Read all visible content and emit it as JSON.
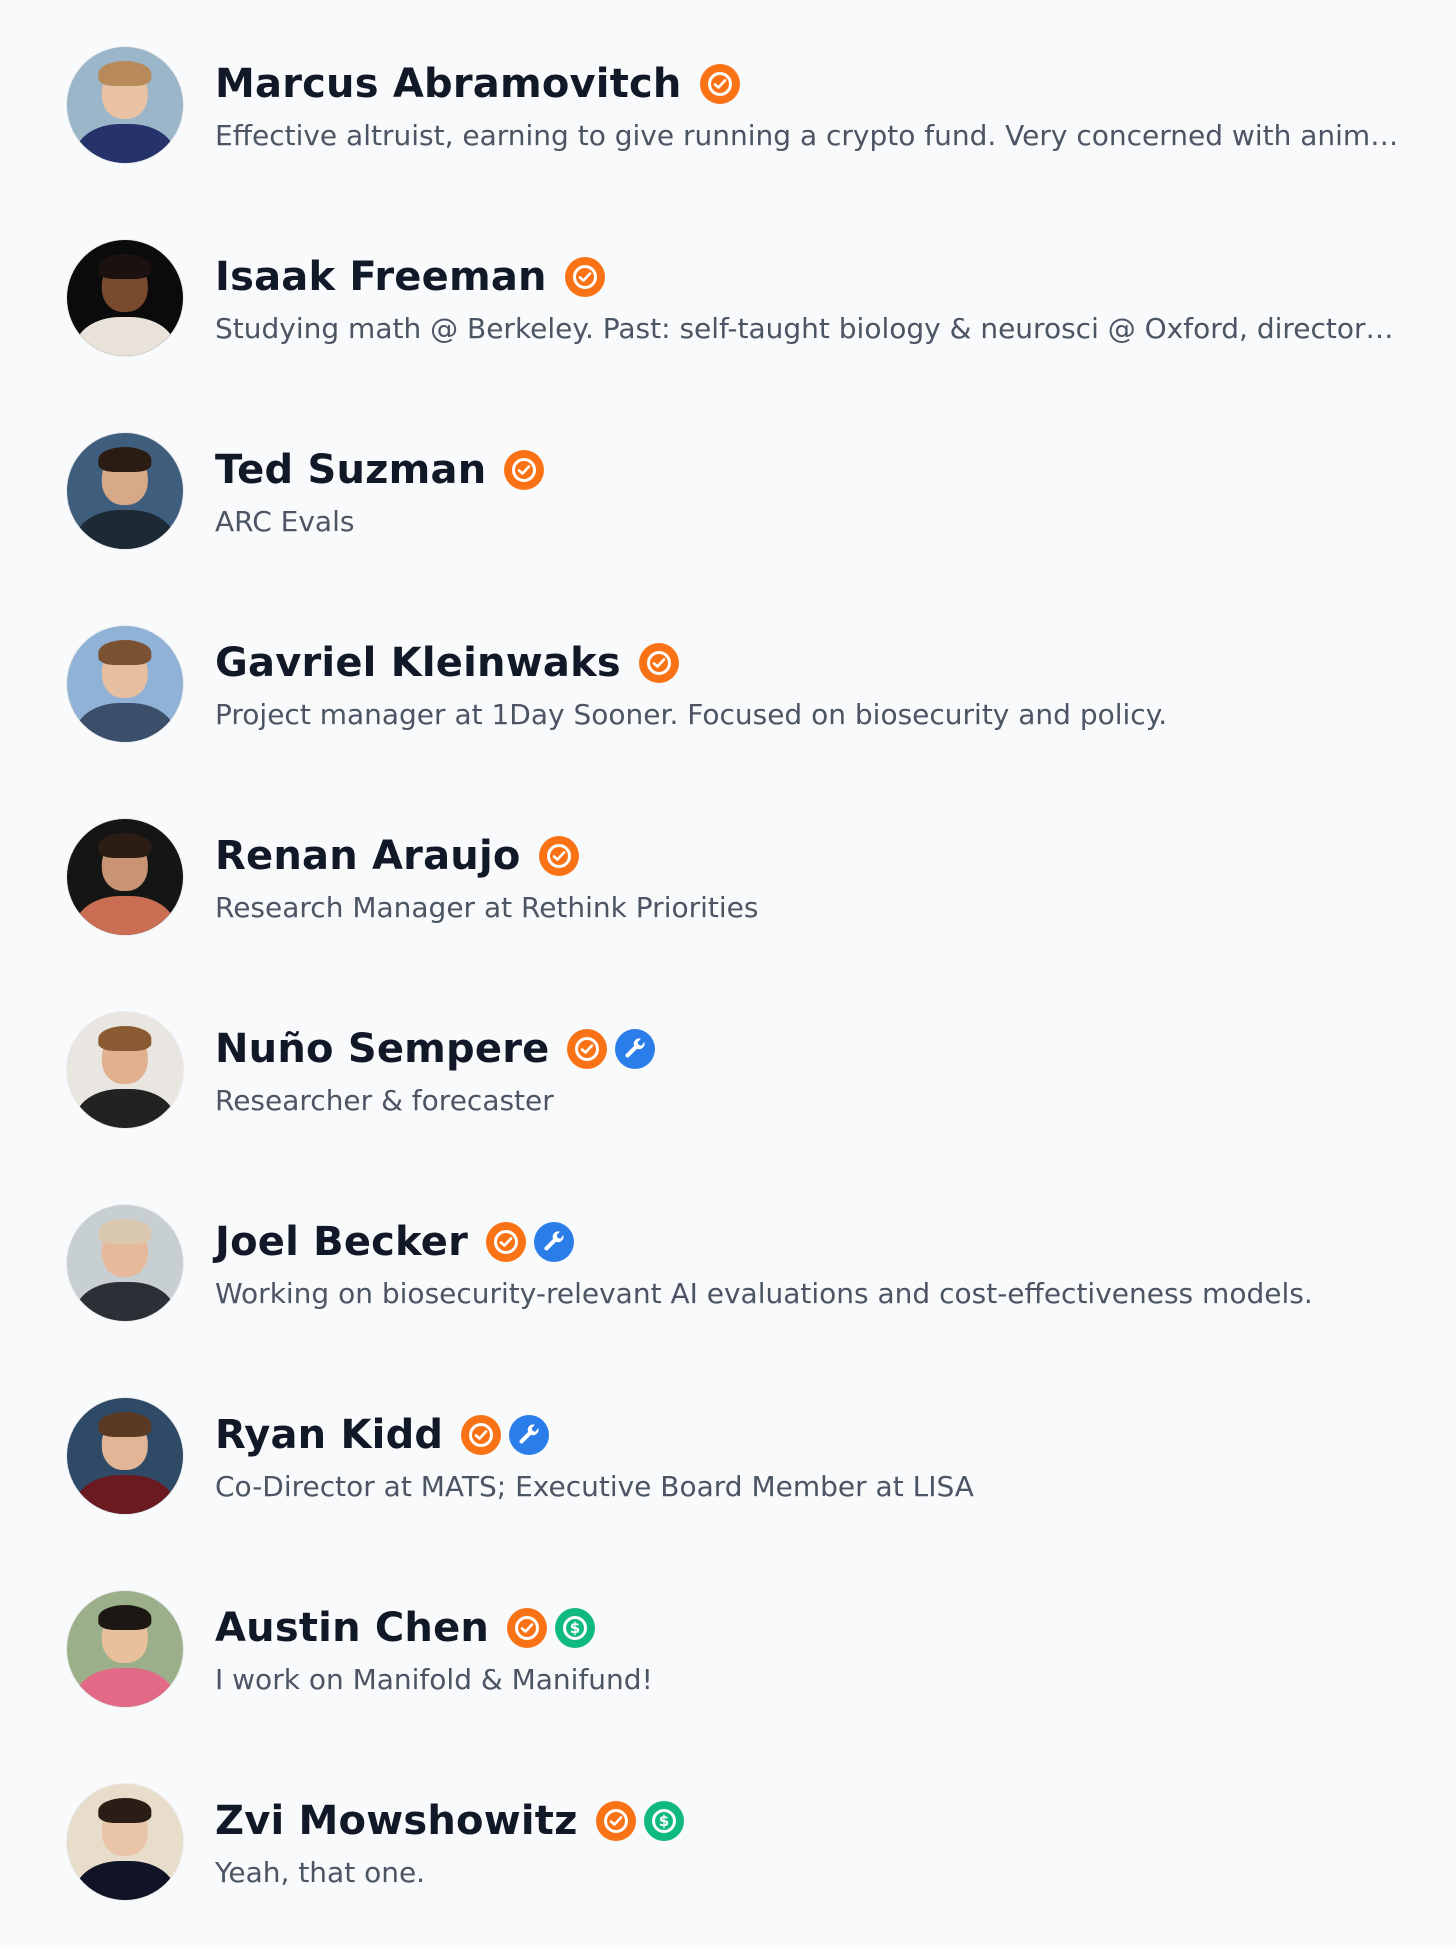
{
  "users": [
    {
      "name": "Marcus Abramovitch",
      "bio": "Effective altruist, earning to give running a crypto fund. Very concerned with animal…",
      "badges": [
        "verified"
      ],
      "avatar": {
        "bg": "#9bb6c9",
        "skin": "#e9c2a4",
        "hair": "#b88a5a",
        "shirt": "#26336b"
      }
    },
    {
      "name": "Isaak Freeman",
      "bio": "Studying math @ Berkeley. Past: self-taught biology & neurosci @ Oxford, director …",
      "badges": [
        "verified"
      ],
      "avatar": {
        "bg": "#0b0b0b",
        "skin": "#7a4a2e",
        "hair": "#1a1110",
        "shirt": "#e8e2da"
      }
    },
    {
      "name": "Ted Suzman",
      "bio": "ARC Evals",
      "badges": [
        "verified"
      ],
      "avatar": {
        "bg": "#3f5e7d",
        "skin": "#d8a988",
        "hair": "#2b1c13",
        "shirt": "#1d2a36"
      }
    },
    {
      "name": "Gavriel Kleinwaks",
      "bio": "Project manager at 1Day Sooner. Focused on biosecurity and policy.",
      "badges": [
        "verified"
      ],
      "avatar": {
        "bg": "#8fb2d6",
        "skin": "#e5bfa0",
        "hair": "#7a5233",
        "shirt": "#3b4f6b"
      }
    },
    {
      "name": "Renan Araujo",
      "bio": "Research Manager at Rethink Priorities",
      "badges": [
        "verified"
      ],
      "avatar": {
        "bg": "#151515",
        "skin": "#c99473",
        "hair": "#2b1d14",
        "shirt": "#c96e52"
      }
    },
    {
      "name": "Nuño Sempere",
      "bio": "Researcher & forecaster",
      "badges": [
        "verified",
        "creator"
      ],
      "avatar": {
        "bg": "#e9e6e1",
        "skin": "#e0b08f",
        "hair": "#8a5a32",
        "shirt": "#222222"
      }
    },
    {
      "name": "Joel Becker",
      "bio": "Working on biosecurity-relevant AI evaluations and cost-effectiveness models.",
      "badges": [
        "verified",
        "creator"
      ],
      "avatar": {
        "bg": "#c8cfd2",
        "skin": "#e6b99a",
        "hair": "#d9c7b0",
        "shirt": "#2b2f36"
      }
    },
    {
      "name": "Ryan Kidd",
      "bio": "Co-Director at MATS; Executive Board Member at LISA",
      "badges": [
        "verified",
        "creator"
      ],
      "avatar": {
        "bg": "#2e4a66",
        "skin": "#e2b597",
        "hair": "#5a3a22",
        "shirt": "#6b1a22"
      }
    },
    {
      "name": "Austin Chen",
      "bio": "I work on Manifold & Manifund!",
      "badges": [
        "verified",
        "donor"
      ],
      "avatar": {
        "bg": "#9bb08a",
        "skin": "#e8c09c",
        "hair": "#1c1712",
        "shirt": "#e26a86"
      }
    },
    {
      "name": "Zvi Mowshowitz",
      "bio": "Yeah, that one.",
      "badges": [
        "verified",
        "donor"
      ],
      "avatar": {
        "bg": "#e8dccb",
        "skin": "#e9c4a8",
        "hair": "#2a1d16",
        "shirt": "#101426"
      }
    }
  ],
  "icons": {
    "verified": "check-circle-icon",
    "creator": "wrench-icon",
    "donor": "dollar-circle-icon"
  },
  "colors": {
    "verified": "#f97316",
    "creator": "#2b7de9",
    "donor": "#10b981",
    "name": "#111827",
    "bio": "#4b5563",
    "background": "#f9fafb"
  }
}
